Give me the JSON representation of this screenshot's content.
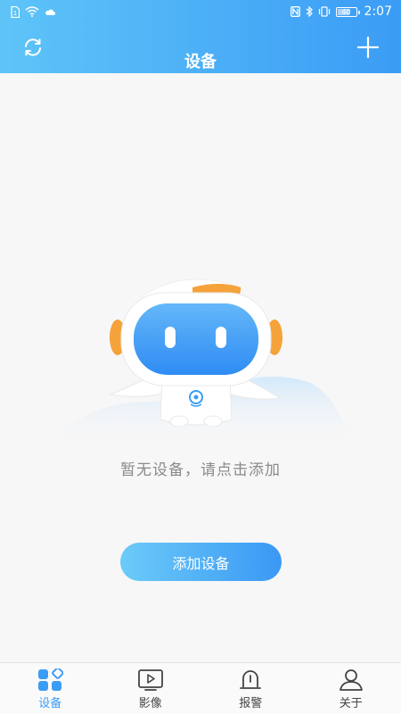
{
  "status_bar": {
    "sim_label": "1",
    "time": "2:07",
    "battery_text": "40"
  },
  "header": {
    "title": "设备",
    "refresh_icon": "refresh-icon",
    "add_icon": "plus-icon"
  },
  "empty_state": {
    "message": "暂无设备，请点击添加"
  },
  "add_device_button": {
    "label": "添加设备"
  },
  "bottom_nav": {
    "items": [
      {
        "label": "设备",
        "icon": "devices-icon",
        "active": true
      },
      {
        "label": "影像",
        "icon": "video-icon",
        "active": false
      },
      {
        "label": "报警",
        "icon": "alarm-icon",
        "active": false
      },
      {
        "label": "关于",
        "icon": "user-icon",
        "active": false
      }
    ]
  },
  "colors": {
    "accent": "#3a9cf5",
    "header_start": "#5ec4f8",
    "header_end": "#3b9cf5",
    "robot_ear": "#f5a23a"
  }
}
